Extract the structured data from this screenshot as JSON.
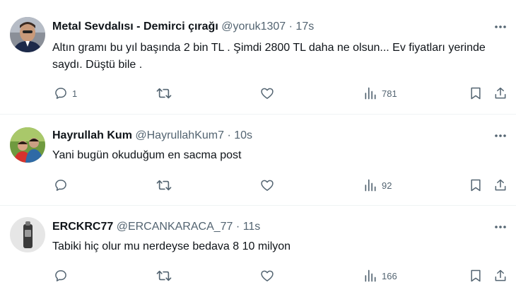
{
  "replies": [
    {
      "name": "Metal Sevdalısı - Demirci çırağı",
      "handle": "@yoruk1307",
      "dot": "·",
      "time": "17s",
      "text": "Altın gramı bu yıl başında 2 bin TL  . Şimdi 2800 TL daha ne olsun... Ev fiyatları yerinde saydı. Düştü bile .",
      "reply_count": "1",
      "views": "781",
      "avatar_icon": "man-photo"
    },
    {
      "name": "Hayrullah Kum",
      "handle": "@HayrullahKum7",
      "dot": "·",
      "time": "10s",
      "text": "Yani bugün okuduğum en sacma post",
      "reply_count": "",
      "views": "92",
      "avatar_icon": "two-people-outdoor-photo"
    },
    {
      "name": "ERCKRC77",
      "handle": "@ERCANKARACA_77",
      "dot": "·",
      "time": "11s",
      "text": "Tabiki hiç olur mu nerdeyse bedava 8 10 milyon",
      "reply_count": "",
      "views": "166",
      "avatar_icon": "object-photo"
    }
  ],
  "colors": {
    "text": "#0f1419",
    "secondary": "#536471",
    "divider": "#eff3f4"
  }
}
